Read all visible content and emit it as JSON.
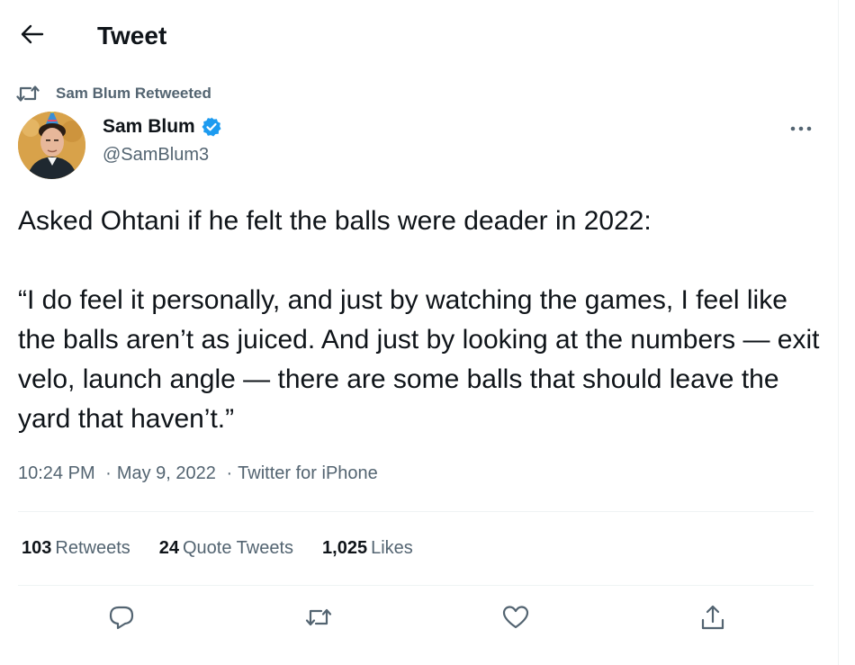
{
  "header": {
    "title": "Tweet",
    "back_icon": "arrow-left-icon"
  },
  "retweet_context": {
    "icon": "retweet-icon",
    "text": "Sam Blum Retweeted"
  },
  "author": {
    "name": "Sam Blum",
    "handle": "@SamBlum3",
    "verified": true,
    "avatar_icon": "avatar-party-hat"
  },
  "tweet": {
    "paragraphs": [
      "Asked Ohtani if he felt the balls were deader in 2022:",
      "“I do feel it personally, and just by watching the games, I feel like the balls aren’t as juiced. And just by looking at the numbers — exit velo, launch angle — there are some balls that should leave the yard that haven’t.”"
    ],
    "time": "10:24 PM",
    "date": "May 9, 2022",
    "source": "Twitter for iPhone",
    "separator": "·"
  },
  "stats": {
    "retweets": {
      "count": "103",
      "label": "Retweets"
    },
    "quote_tweets": {
      "count": "24",
      "label": "Quote Tweets"
    },
    "likes": {
      "count": "1,025",
      "label": "Likes"
    }
  },
  "actions": [
    "reply-icon",
    "retweet-icon",
    "like-icon",
    "share-icon"
  ],
  "colors": {
    "text_primary": "#0f1419",
    "text_secondary": "#536471",
    "verified_blue": "#1d9bf0",
    "divider": "#eff3f4"
  }
}
